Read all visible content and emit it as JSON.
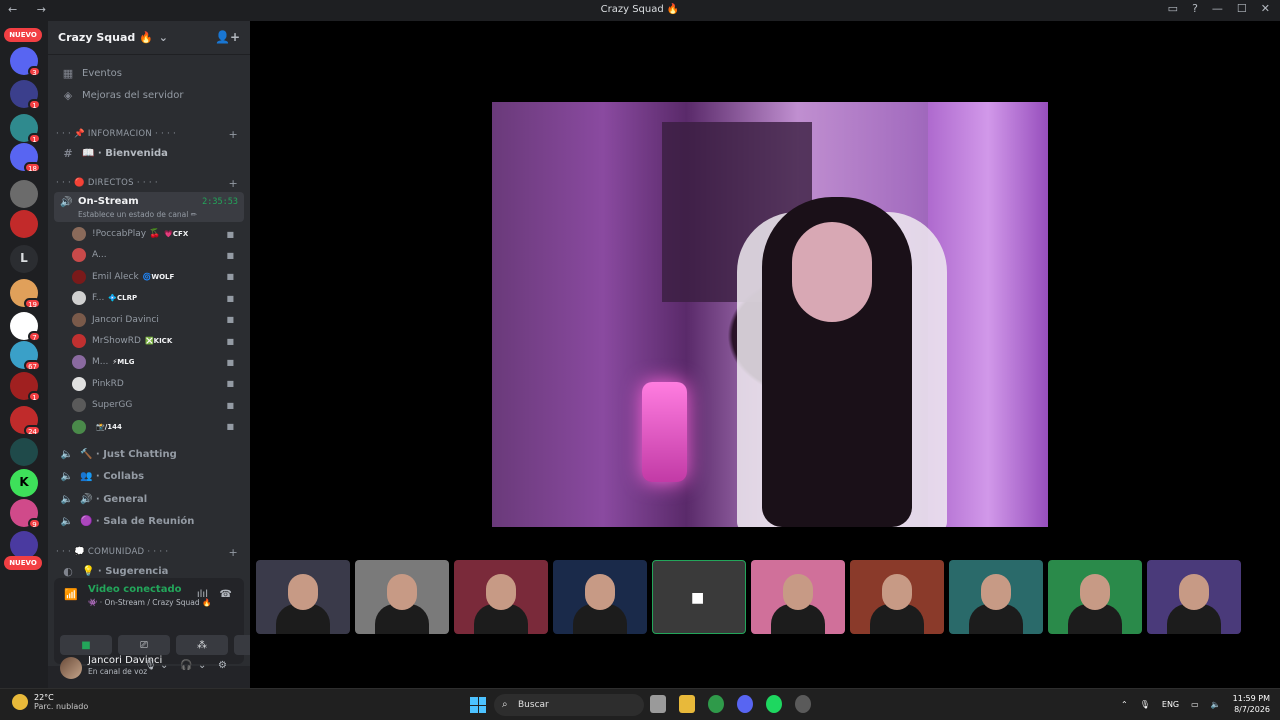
{
  "window": {
    "title": "Crazy Squad 🔥"
  },
  "rail": {
    "nuevo_label": "NUEVO",
    "items": [
      {
        "badge": "3",
        "color": "#5865f2"
      },
      {
        "badge": "1",
        "color": "#3b3f8c"
      },
      {
        "badge": "1",
        "color": "#2f8a8e"
      },
      {
        "badge": "18",
        "color": "#5865f2"
      },
      {
        "badge": "",
        "color": "#6b6b6b"
      },
      {
        "badge": "",
        "color": "#c22a2a"
      },
      {
        "badge": "",
        "color": "#2b2d31",
        "letter": "L"
      },
      {
        "badge": "19",
        "color": "#e0a05a"
      },
      {
        "badge": "7",
        "color": "#ffffff"
      },
      {
        "badge": "67",
        "color": "#3aa0c8"
      },
      {
        "badge": "1",
        "color": "#a02020"
      },
      {
        "badge": "24",
        "color": "#c02b2b"
      },
      {
        "badge": "",
        "color": "#1f4a4a"
      },
      {
        "badge": "",
        "color": "#3ee05a",
        "letter": "K"
      },
      {
        "badge": "9",
        "color": "#d04a8a"
      },
      {
        "badge": "",
        "color": "#4a3aa0"
      }
    ]
  },
  "sidebar": {
    "server_name": "Crazy Squad 🔥",
    "top_items": [
      "Eventos",
      "Mejoras del servidor"
    ],
    "cat_info": "· · · 📌 INFORMACION · · · ·",
    "welcome_channel": "📖 · Bienvenida",
    "cat_directos": "· · · 🔴 DIRECTOS · · · ·",
    "voice_active": {
      "name": "On-Stream",
      "sub": "Establece un estado de canal ✏",
      "time": "2:35:53"
    },
    "users": [
      {
        "name": "!PoccabPlay 🍒",
        "tag": "💗CFX",
        "color": "#8a6a5a"
      },
      {
        "name": "A...",
        "tag": "",
        "color": "#c84a4a"
      },
      {
        "name": "Emil Aleck",
        "tag": "🌀WOLF",
        "color": "#7a1a1a"
      },
      {
        "name": "F...",
        "tag": "💠CLRP",
        "color": "#d0d0d0"
      },
      {
        "name": "Jancori Davinci",
        "tag": "",
        "color": "#7a5a4a"
      },
      {
        "name": "MrShowRD",
        "tag": "❎KICK",
        "color": "#c03030"
      },
      {
        "name": "M...",
        "tag": "⚡MLG",
        "color": "#8a6aa0"
      },
      {
        "name": "PinkRD",
        "tag": "",
        "color": "#e0e0e0"
      },
      {
        "name": "SuperGG",
        "tag": "",
        "color": "#5a5a5a"
      },
      {
        "name": "",
        "tag": "📸/144",
        "color": "#4a8a4a"
      }
    ],
    "voice_channels": [
      "🔨 · Just Chatting",
      "👥 · Collabs",
      "🔊 · General",
      "🟣 · Sala de Reunión"
    ],
    "cat_comunidad": "· · · 💭 COMUNIDAD · · · ·",
    "sugerencia": "💡 · Sugerencia"
  },
  "voice_panel": {
    "status": "Video conectado",
    "location": "👾 · On-Stream / Crazy Squad 🔥"
  },
  "user": {
    "name": "Jancori Davinci",
    "status": "En canal de voz"
  },
  "taskbar": {
    "temp": "22°C",
    "weather": "Parc. nublado",
    "search": "Buscar",
    "lang": "ENG",
    "time": "11:59 PM",
    "date": "8/7/2026"
  },
  "thumbs": [
    {
      "bg": "#3a3a4a"
    },
    {
      "bg": "#7a7a7a"
    },
    {
      "bg": "#7a2a3a"
    },
    {
      "bg": "#1a2a4a"
    },
    {
      "bg": "#3a3a3a",
      "selected": true
    },
    {
      "bg": "#d0709a"
    },
    {
      "bg": "#8a3a2a"
    },
    {
      "bg": "#2a6a6a"
    },
    {
      "bg": "#2a8a4a"
    },
    {
      "bg": "#4a3a7a"
    }
  ]
}
